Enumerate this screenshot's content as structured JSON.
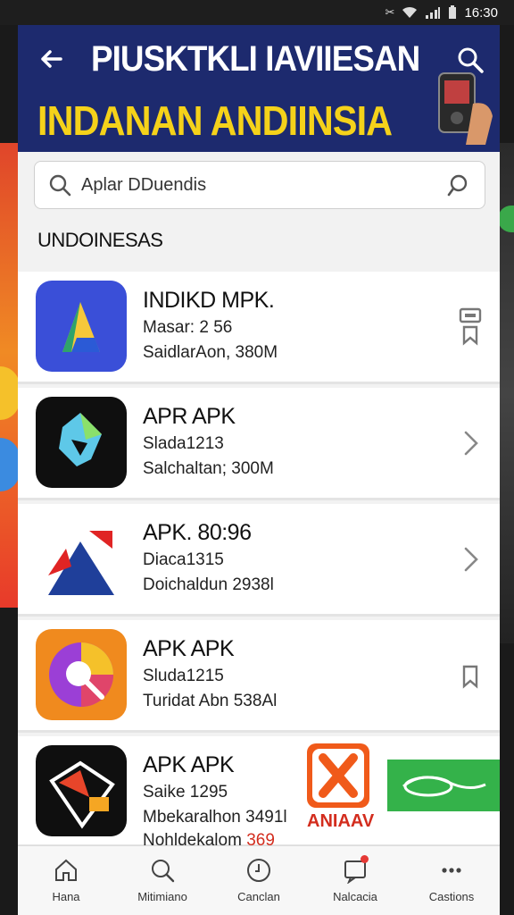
{
  "status_bar": {
    "time": "16:30",
    "icons": [
      "tools-icon",
      "wifi-icon",
      "signal-icon",
      "battery-icon"
    ]
  },
  "header": {
    "title": "PIUSKTKLI IAVIIESAN",
    "subtitle": "INDANAN ANDIINSIA",
    "background": "#1d2a6e",
    "subtitle_color": "#f5d21a"
  },
  "search": {
    "value": "Aplar DDuendis"
  },
  "section": {
    "title": "UNDOINESAS"
  },
  "apps": [
    {
      "name": "INDIKD MPK.",
      "line1": "Masar: 2 56",
      "line2": "SaidlarAon, 380M",
      "line3": "",
      "trail": "bookmark-icon"
    },
    {
      "name": "APR APK",
      "line1": "Slada1213",
      "line2": "Salchaltan; 300M",
      "line3": "",
      "trail": "chevron-right-icon"
    },
    {
      "name": "APK. 80:96",
      "line1": "Diaca1315",
      "line2": "Doichaldun 2938l",
      "line3": "",
      "trail": "chevron-right-icon"
    },
    {
      "name": "APK APK",
      "line1": "Sluda1215",
      "line2": "Turidat Abn 538Al",
      "line3": "",
      "trail": "bookmark-icon"
    },
    {
      "name": "APK APK",
      "line1": "Saike 1295",
      "line2": "Mbekaralhon 3491l",
      "line3": "Nohldekalom",
      "trail": ""
    }
  ],
  "ad": {
    "label": "ANIAAV",
    "count": "369"
  },
  "bottom_nav": [
    {
      "label": "Hana",
      "icon": "home-icon"
    },
    {
      "label": "Mitimiano",
      "icon": "search-icon"
    },
    {
      "label": "Canclan",
      "icon": "clock-icon"
    },
    {
      "label": "Nalcacia",
      "icon": "notification-icon"
    },
    {
      "label": "Castions",
      "icon": "more-icon"
    }
  ]
}
